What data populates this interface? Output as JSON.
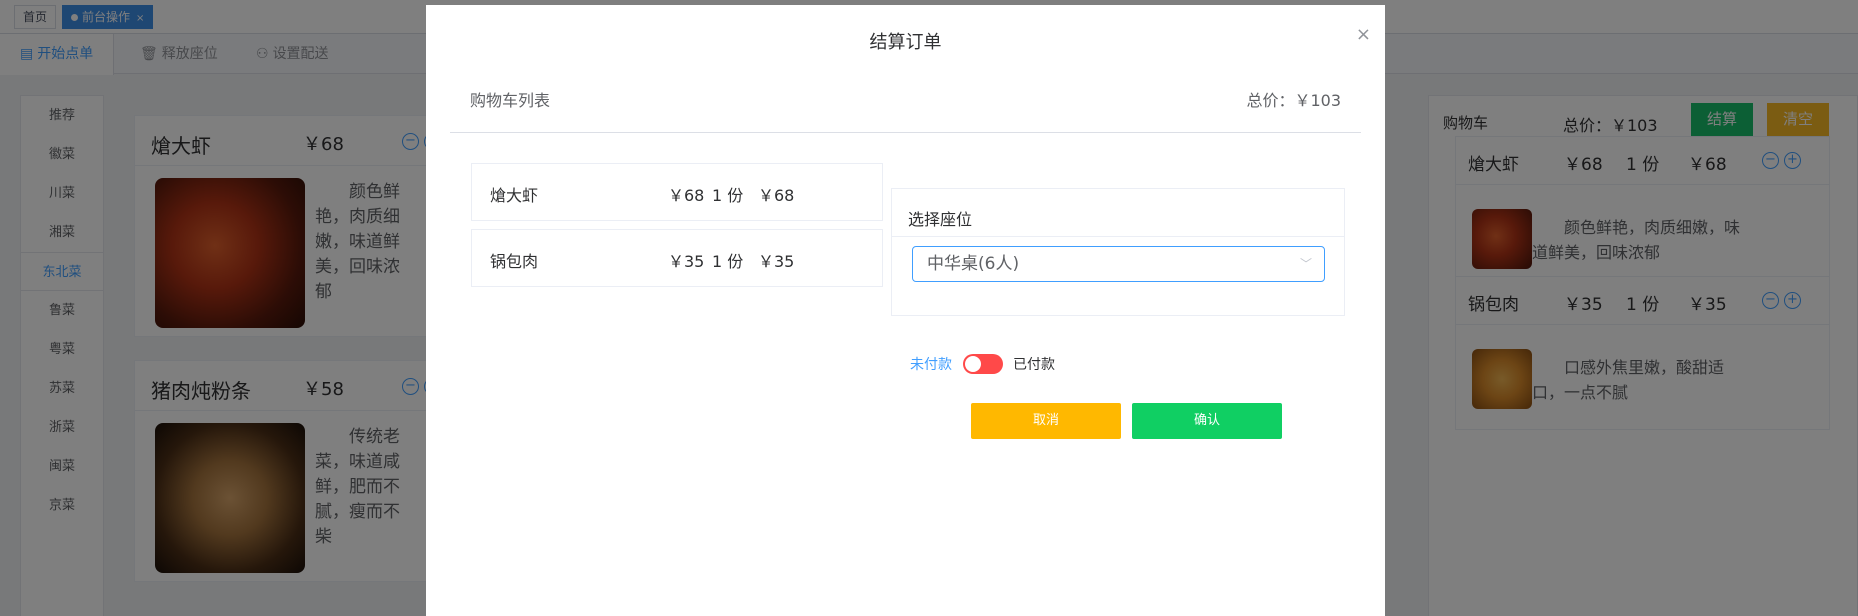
{
  "tags": {
    "home": "首页",
    "active": "前台操作",
    "close": "×"
  },
  "tabs": [
    {
      "label": "开始点单",
      "icon": "document-icon"
    },
    {
      "label": "释放座位",
      "icon": "trash-icon"
    },
    {
      "label": "设置配送",
      "icon": "user-icon"
    }
  ],
  "categories": [
    "推荐",
    "徽菜",
    "川菜",
    "湘菜",
    "东北菜",
    "鲁菜",
    "粤菜",
    "苏菜",
    "浙菜",
    "闽菜",
    "京菜"
  ],
  "active_category": "东北菜",
  "dishes": [
    {
      "name": "熗大虾",
      "price": "￥68",
      "desc": "颜色鲜艳，肉质细嫩，味道鲜美，回味浓郁",
      "minus": "−",
      "plus": "+"
    },
    {
      "name": "猪肉炖粉条",
      "price": "￥58",
      "desc": "传统老菜，味道咸鲜，肥而不腻，瘦而不柴",
      "minus": "−",
      "plus": "+"
    }
  ],
  "cart": {
    "title": "购物车",
    "total": "总价：￥103",
    "settle": "结算",
    "clear": "清空",
    "items": [
      {
        "name": "熗大虾",
        "unit": "￥68",
        "qty": "1 份",
        "sum": "￥68",
        "desc": "颜色鲜艳，肉质细嫩，味道鲜美，回味浓郁"
      },
      {
        "name": "锅包肉",
        "unit": "￥35",
        "qty": "1 份",
        "sum": "￥35",
        "desc": "口感外焦里嫩，酸甜适口，一点不腻"
      }
    ]
  },
  "dialog": {
    "title": "结算订单",
    "close": "×",
    "cart_list_title": "购物车列表",
    "total": "总价：￥103",
    "lines": [
      {
        "name": "熗大虾",
        "unit": "￥68",
        "qty": "1 份",
        "sum": "￥68"
      },
      {
        "name": "锅包肉",
        "unit": "￥35",
        "qty": "1 份",
        "sum": "￥35"
      }
    ],
    "seat_title": "选择座位",
    "seat_value": "中华桌(6人)",
    "unpaid": "未付款",
    "paid": "已付款",
    "paid_state": false,
    "cancel": "取消",
    "confirm": "确认"
  }
}
